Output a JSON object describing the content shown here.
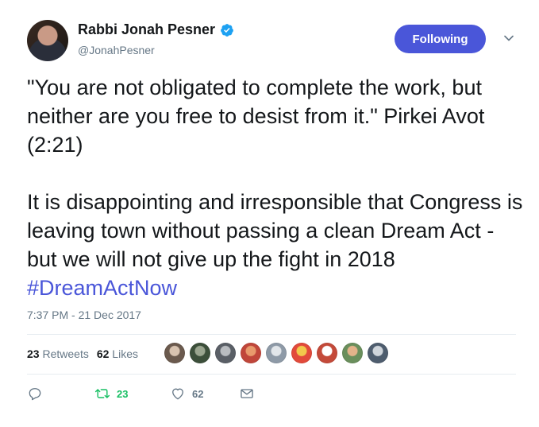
{
  "author": {
    "name": "Rabbi Jonah Pesner",
    "handle": "@JonahPesner",
    "verified": true
  },
  "follow_button": {
    "label": "Following",
    "color": "#4a56d9"
  },
  "tweet": {
    "text": "\"You are not obligated to complete the work, but neither are you free to desist from it.\" Pirkei Avot (2:21)\n\nIt is disappointing and irresponsible that Congress is leaving town without passing a clean Dream Act - but we will not give up the fight in 2018 ",
    "hashtag": "#DreamActNow",
    "timestamp": "7:37 PM - 21 Dec 2017"
  },
  "stats": {
    "retweets_count": "23",
    "retweets_label": "Retweets",
    "likes_count": "62",
    "likes_label": "Likes"
  },
  "liker_avatars": [
    {
      "colors": [
        "#6b5a4e",
        "#d8c3b0"
      ]
    },
    {
      "colors": [
        "#3c4f3a",
        "#9aa58f"
      ]
    },
    {
      "colors": [
        "#5a5f66",
        "#b9bcc0"
      ]
    },
    {
      "colors": [
        "#c0463a",
        "#e89a6c"
      ]
    },
    {
      "colors": [
        "#8e9aa7",
        "#e2e6ea"
      ]
    },
    {
      "colors": [
        "#e24a3b",
        "#f2c94c"
      ]
    },
    {
      "colors": [
        "#c44a3a",
        "#ffffff"
      ]
    },
    {
      "colors": [
        "#6a8f5c",
        "#e3b38a"
      ]
    },
    {
      "colors": [
        "#4e5d6e",
        "#cfd5db"
      ]
    }
  ],
  "actions": {
    "reply_icon": "reply-icon",
    "retweet_count": "23",
    "like_count": "62",
    "dm_icon": "envelope-icon",
    "retweet_color": "#17bf63",
    "icon_color": "#657786"
  }
}
